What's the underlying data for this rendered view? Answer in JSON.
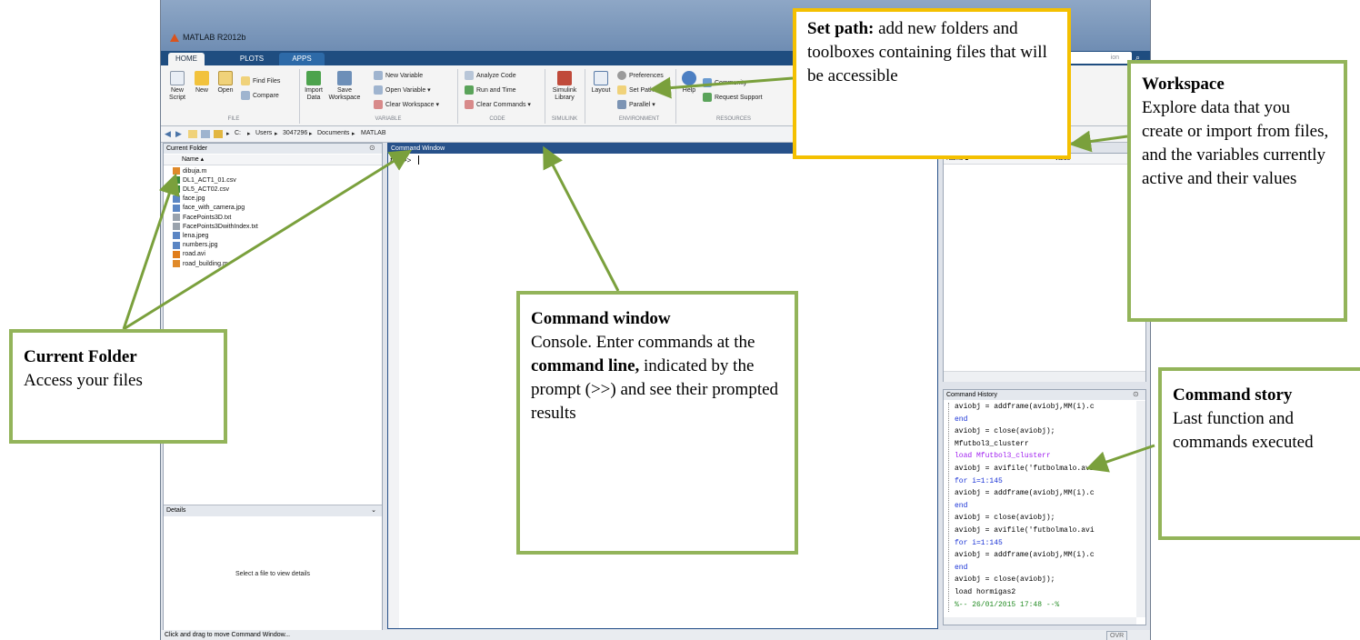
{
  "window": {
    "title": "MATLAB R2012b"
  },
  "tabs": [
    {
      "label": "HOME"
    },
    {
      "label": "PLOTS"
    },
    {
      "label": "APPS"
    }
  ],
  "search": {
    "placeholder": "ion"
  },
  "ribbon": {
    "file": {
      "new_script": "New\nScript",
      "new": "New",
      "open": "Open",
      "find_files": "Find Files",
      "compare": "Compare",
      "label": "FILE"
    },
    "variable": {
      "import_data": "Import\nData",
      "save_workspace": "Save\nWorkspace",
      "new_variable": "New Variable",
      "open_variable": "Open Variable ▾",
      "clear_workspace": "Clear Workspace ▾",
      "label": "VARIABLE"
    },
    "code": {
      "analyze_code": "Analyze Code",
      "run_and_time": "Run and Time",
      "clear_commands": "Clear Commands ▾",
      "label": "CODE"
    },
    "simulink": {
      "library": "Simulink\nLibrary",
      "label": "SIMULINK"
    },
    "environment": {
      "layout": "Layout",
      "preferences": "Preferences",
      "set_path": "Set Path",
      "parallel": "Parallel ▾",
      "label": "ENVIRONMENT"
    },
    "resources": {
      "help": "Help",
      "community": "Community",
      "request_support": "Request Support",
      "label": "RESOURCES"
    }
  },
  "path": {
    "segments": [
      "C:",
      "Users",
      "3047296",
      "Documents",
      "MATLAB"
    ]
  },
  "current_folder": {
    "title": "Current Folder",
    "name_header": "Name ▴",
    "files": [
      "dibuja.m",
      "DL1_ACT1_01.csv",
      "DL5_ACT02.csv",
      "face.jpg",
      "face_with_camera.jpg",
      "FacePoints3D.txt",
      "FacePoints3DwithIndex.txt",
      "lena.jpeg",
      "numbers.jpg",
      "road.avi",
      "road_building.m"
    ],
    "details_title": "Details",
    "details_text": "Select a file to view details"
  },
  "command_window": {
    "title": "Command Window",
    "fx": "fx",
    "prompt": ">>"
  },
  "workspace": {
    "name_header": "Name ▴",
    "value_header": "Value"
  },
  "command_history": {
    "title": "Command History",
    "lines": [
      {
        "text": "aviobj = addframe(aviobj,MM(i).c",
        "color": "#000000"
      },
      {
        "text": "end",
        "color": "#1a33d6"
      },
      {
        "text": "aviobj = close(aviobj);",
        "color": "#000000"
      },
      {
        "text": "Mfutbol3_clusterr",
        "color": "#000000"
      },
      {
        "text": "load Mfutbol3_clusterr",
        "color": "#a020f0"
      },
      {
        "text": "aviobj = avifile('futbolmalo.avi",
        "color": "#000000"
      },
      {
        "text": "for i=1:145",
        "color": "#1a33d6"
      },
      {
        "text": "aviobj = addframe(aviobj,MM(i).c",
        "color": "#000000"
      },
      {
        "text": "end",
        "color": "#1a33d6"
      },
      {
        "text": "aviobj = close(aviobj);",
        "color": "#000000"
      },
      {
        "text": "aviobj = avifile('futbolmalo.avi",
        "color": "#000000"
      },
      {
        "text": "for i=1:145",
        "color": "#1a33d6"
      },
      {
        "text": "aviobj = addframe(aviobj,MM(i).c",
        "color": "#000000"
      },
      {
        "text": "end",
        "color": "#1a33d6"
      },
      {
        "text": "aviobj = close(aviobj);",
        "color": "#000000"
      },
      {
        "text": "load hormigas2",
        "color": "#000000"
      },
      {
        "text": "%-- 26/01/2015 17:48 --%",
        "color": "#228b22"
      }
    ]
  },
  "status": {
    "text": "Click and drag to move Command Window...",
    "ovr": "OVR"
  },
  "callouts": {
    "set_path": {
      "title": "Set path:",
      "body": " add new folders and toolboxes containing files that will be accessible"
    },
    "workspace": {
      "title": "Workspace",
      "body": "Explore data that you create or import from files, and the variables currently active and their values"
    },
    "current_folder": {
      "title": "Current Folder",
      "body": "Access your files"
    },
    "command_window": {
      "title": "Command window",
      "body1": "Console. Enter commands at the ",
      "bold": "command line,",
      "body2": " indicated by the prompt (>>) and see their prompted results"
    },
    "command_story": {
      "title": "Command story",
      "body": "Last function and commands executed"
    }
  },
  "colors": {
    "callout_border": "#93b45a",
    "setpath_border": "#f4c000",
    "tab_bar": "#1f4d80"
  }
}
